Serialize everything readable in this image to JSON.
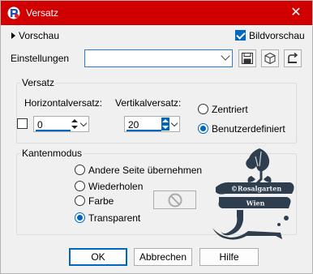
{
  "window": {
    "title": "Versatz",
    "close": "✕",
    "accent_color": "#d10000"
  },
  "preview": {
    "toggle_label": "Vorschau",
    "bildvorschau_label": "Bildvorschau",
    "bildvorschau_checked": true
  },
  "settings": {
    "label": "Einstellungen",
    "value": ""
  },
  "offset_group": {
    "title": "Versatz",
    "horizontal_label": "Horizontalversatz:",
    "horizontal_value": "0",
    "vertical_label": "Vertikalversatz:",
    "vertical_value": "20",
    "zentriert_label": "Zentriert",
    "benutzer_label": "Benutzerdefiniert",
    "selected": "Benutzerdefiniert"
  },
  "edge_group": {
    "title": "Kantenmodus",
    "options": [
      "Andere Seite übernehmen",
      "Wiederholen",
      "Farbe",
      "Transparent"
    ],
    "selected": "Transparent"
  },
  "watermark": {
    "line1": "©Rosalgarten",
    "line2": "Wien"
  },
  "buttons": {
    "ok": "OK",
    "cancel": "Abbrechen",
    "help": "Hilfe"
  }
}
